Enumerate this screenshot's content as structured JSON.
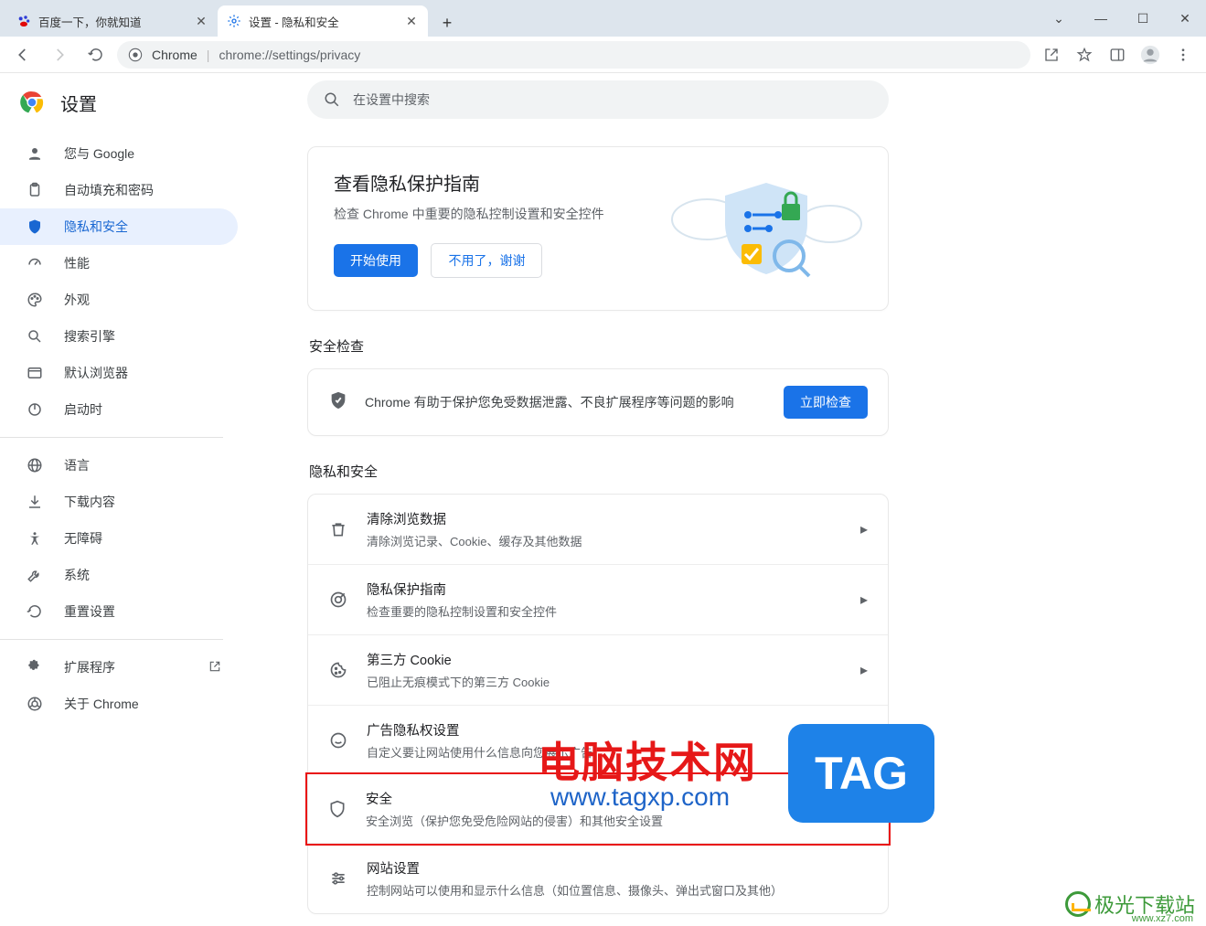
{
  "window": {
    "title_bar": ""
  },
  "tabs": {
    "items": [
      {
        "title": "百度一下，你就知道",
        "favicon": "baidu"
      },
      {
        "title": "设置 - 隐私和安全",
        "favicon": "gear"
      }
    ],
    "active_index": 1
  },
  "toolbar": {
    "omnibox_chip": "Chrome",
    "omnibox_url": "chrome://settings/privacy"
  },
  "settings_header": {
    "title": "设置",
    "search_placeholder": "在设置中搜索"
  },
  "sidebar": {
    "items": [
      {
        "label": "您与 Google",
        "icon": "person"
      },
      {
        "label": "自动填充和密码",
        "icon": "clipboard"
      },
      {
        "label": "隐私和安全",
        "icon": "shield",
        "active": true
      },
      {
        "label": "性能",
        "icon": "speed"
      },
      {
        "label": "外观",
        "icon": "palette"
      },
      {
        "label": "搜索引擎",
        "icon": "search"
      },
      {
        "label": "默认浏览器",
        "icon": "browser"
      },
      {
        "label": "启动时",
        "icon": "power"
      }
    ],
    "secondary": [
      {
        "label": "语言",
        "icon": "globe"
      },
      {
        "label": "下载内容",
        "icon": "download"
      },
      {
        "label": "无障碍",
        "icon": "accessibility"
      },
      {
        "label": "系统",
        "icon": "wrench"
      },
      {
        "label": "重置设置",
        "icon": "restore"
      }
    ],
    "tertiary": [
      {
        "label": "扩展程序",
        "icon": "extension",
        "external": true
      },
      {
        "label": "关于 Chrome",
        "icon": "chrome"
      }
    ]
  },
  "guide_card": {
    "title": "查看隐私保护指南",
    "subtitle": "检查 Chrome 中重要的隐私控制设置和安全控件",
    "primary_button": "开始使用",
    "secondary_button": "不用了，谢谢"
  },
  "sections": {
    "safety_check": "安全检查",
    "privacy_security": "隐私和安全"
  },
  "safety_row": {
    "text": "Chrome 有助于保护您免受数据泄露、不良扩展程序等问题的影响",
    "button": "立即检查"
  },
  "privacy_list": [
    {
      "icon": "trash",
      "title": "清除浏览数据",
      "sub": "清除浏览记录、Cookie、缓存及其他数据"
    },
    {
      "icon": "target",
      "title": "隐私保护指南",
      "sub": "检查重要的隐私控制设置和安全控件"
    },
    {
      "icon": "cookie",
      "title": "第三方 Cookie",
      "sub": "已阻止无痕模式下的第三方 Cookie"
    },
    {
      "icon": "ads",
      "title": "广告隐私权设置",
      "sub": "自定义要让网站使用什么信息向您展示广告"
    },
    {
      "icon": "security",
      "title": "安全",
      "sub": "安全浏览（保护您免受危险网站的侵害）和其他安全设置",
      "highlighted": true
    },
    {
      "icon": "tune",
      "title": "网站设置",
      "sub": "控制网站可以使用和显示什么信息（如位置信息、摄像头、弹出式窗口及其他）"
    }
  ],
  "watermarks": {
    "red_text": "电脑技术网",
    "blue_url": "www.tagxp.com",
    "tag_box": "TAG",
    "green_text": "极光下载站",
    "green_url": "www.xz7.com"
  }
}
